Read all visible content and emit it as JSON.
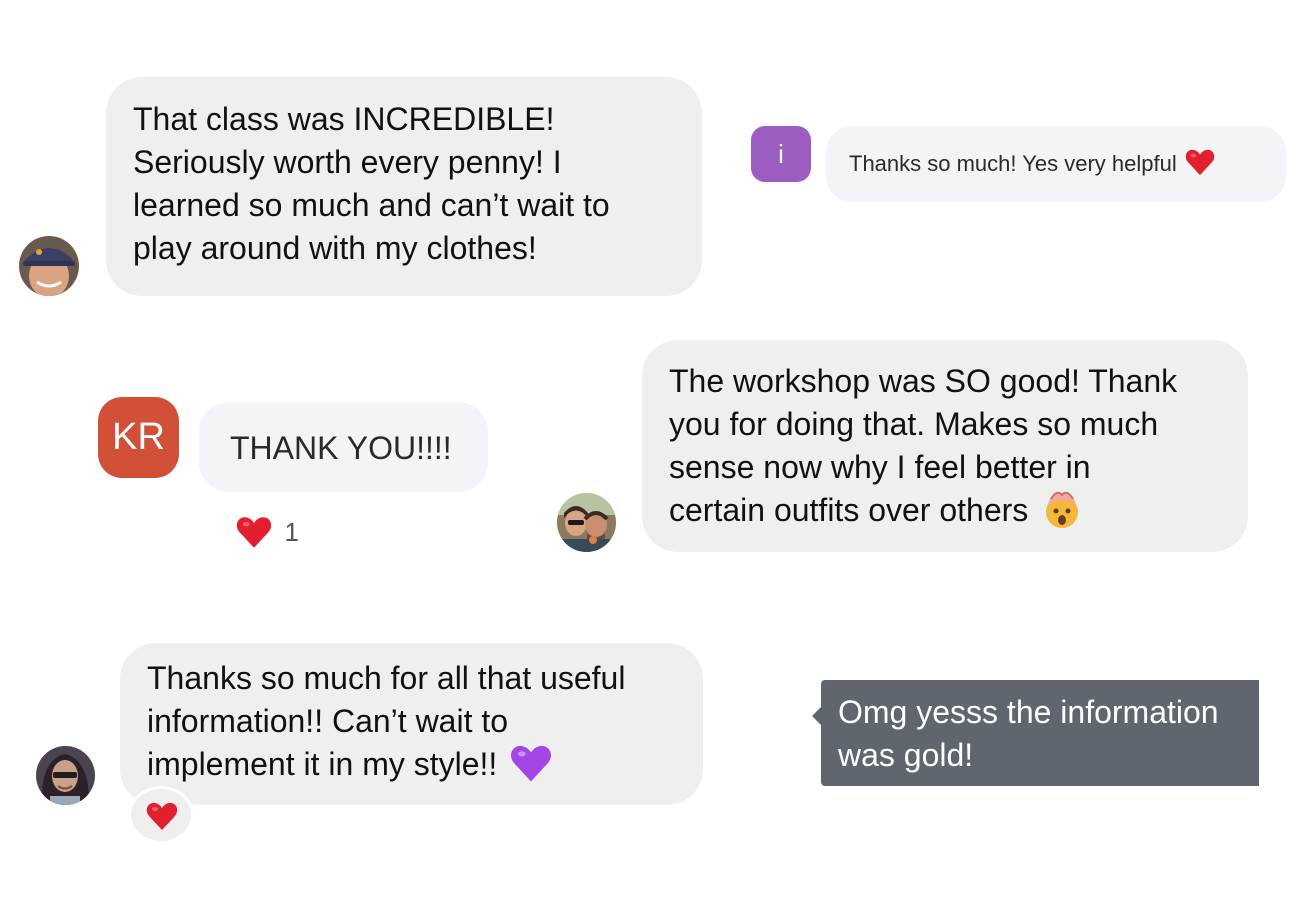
{
  "colors": {
    "bubble_gray": "#efeff0",
    "bubble_light": "#f3f3f8",
    "dark_bubble": "#5f666d",
    "initial_i": "#9d5cc0",
    "initial_kr": "#d24f38",
    "heart": "#e0202e",
    "purple_heart": "#a445e6"
  },
  "messages": {
    "m1": {
      "lines": [
        "That class was INCREDIBLE!",
        "Seriously worth every penny! I",
        "learned so much and can’t wait to",
        "play around with my clothes!"
      ],
      "avatar_icon": "avatar-photo-icon"
    },
    "m2": {
      "avatar_initial": "i",
      "text": "Thanks so much! Yes very helpful",
      "emoji_icon": "red-heart-icon"
    },
    "m3": {
      "avatar_initials": "KR",
      "text": "THANK YOU!!!!",
      "reaction_icon": "red-heart-icon",
      "reaction_count": "1"
    },
    "m4": {
      "lines": [
        "The workshop was SO good! Thank",
        "you for doing that. Makes so much",
        "sense now why I feel better in",
        "certain outfits over others"
      ],
      "emoji_icon": "mind-blown-face-icon",
      "avatar_icon": "avatar-couple-photo-icon"
    },
    "m5": {
      "lines": [
        "Thanks so much for all that useful",
        "information!! Can’t wait to",
        "implement it in my style!!"
      ],
      "emoji_icon": "purple-heart-icon",
      "reaction_icon": "red-heart-icon",
      "avatar_icon": "avatar-photo-icon"
    },
    "m6": {
      "lines": [
        "Omg yesss the information",
        "was gold!"
      ]
    }
  }
}
